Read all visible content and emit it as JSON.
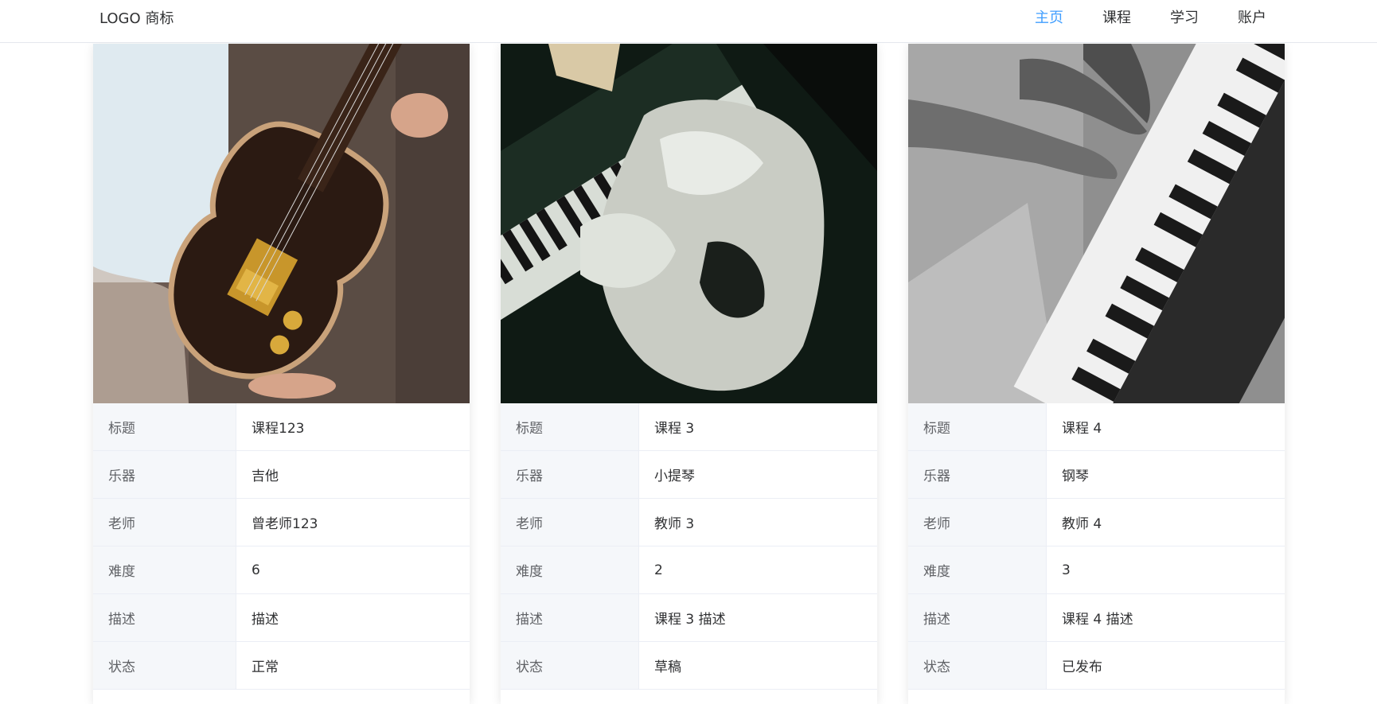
{
  "header": {
    "logo": "LOGO 商标",
    "nav": [
      {
        "label": "主页",
        "active": true
      },
      {
        "label": "课程",
        "active": false
      },
      {
        "label": "学习",
        "active": false
      },
      {
        "label": "账户",
        "active": false
      }
    ]
  },
  "field_labels": {
    "title": "标题",
    "instrument": "乐器",
    "teacher": "老师",
    "difficulty": "难度",
    "description": "描述",
    "status": "状态"
  },
  "courses": [
    {
      "title": "课程123",
      "instrument": "吉他",
      "teacher": "曾老师123",
      "difficulty": "6",
      "description": "描述",
      "status": "正常",
      "image": "electric-guitar-photo"
    },
    {
      "title": "课程 3",
      "instrument": "小提琴",
      "teacher": "教师 3",
      "difficulty": "2",
      "description": "课程 3 描述",
      "status": "草稿",
      "image": "piano-player-photo"
    },
    {
      "title": "课程 4",
      "instrument": "钢琴",
      "teacher": "教师 4",
      "difficulty": "3",
      "description": "课程 4 描述",
      "status": "已发布",
      "image": "piano-hands-bw-photo"
    }
  ],
  "colors": {
    "accent": "#409eff",
    "label_bg": "#f5f7fa",
    "border": "#ebeef5"
  }
}
